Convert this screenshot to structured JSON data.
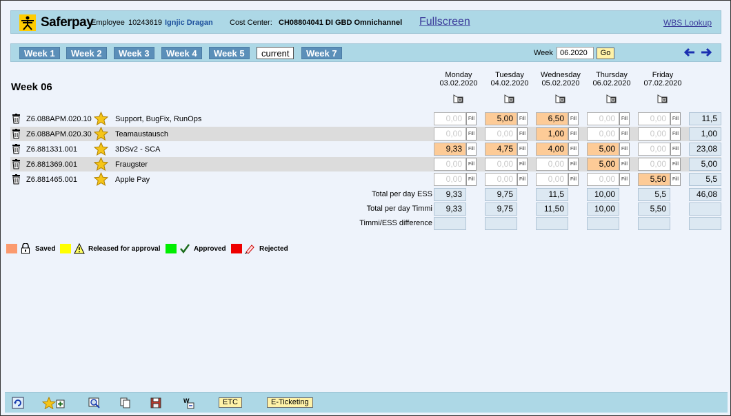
{
  "header": {
    "brand": "Saferpay",
    "employee_label": "Employee",
    "employee_id": "10243619",
    "employee_name": "Ignjic Dragan",
    "cost_center_label": "Cost Center:",
    "cost_center_value": "CH08804041 DI GBD Omnichannel",
    "fullscreen_link": "Fullscreen",
    "wbs_link": "WBS Lookup"
  },
  "week_nav": {
    "tabs": [
      {
        "label": "Week 1"
      },
      {
        "label": "Week 2"
      },
      {
        "label": "Week 3"
      },
      {
        "label": "Week 4"
      },
      {
        "label": "Week 5"
      },
      {
        "label": "current"
      },
      {
        "label": "Week 7"
      }
    ],
    "week_label": "Week",
    "week_value": "06.2020",
    "go_label": "Go"
  },
  "title": "Week 06",
  "days": [
    {
      "name": "Monday",
      "date": "03.02.2020"
    },
    {
      "name": "Tuesday",
      "date": "04.02.2020"
    },
    {
      "name": "Wednesday",
      "date": "05.02.2020"
    },
    {
      "name": "Thursday",
      "date": "06.02.2020"
    },
    {
      "name": "Friday",
      "date": "07.02.2020"
    }
  ],
  "fill_label": "Fill",
  "rows": [
    {
      "wbs": "Z6.088APM.020.10",
      "desc": "Support, BugFix, RunOps",
      "values": [
        "0,00",
        "5,00",
        "6,50",
        "0,00",
        "0,00"
      ],
      "total": "11,5"
    },
    {
      "wbs": "Z6.088APM.020.30",
      "desc": "Teamaustausch",
      "values": [
        "0,00",
        "0,00",
        "1,00",
        "0,00",
        "0,00"
      ],
      "total": "1,00"
    },
    {
      "wbs": "Z6.881331.001",
      "desc": "3DSv2 - SCA",
      "values": [
        "9,33",
        "4,75",
        "4,00",
        "5,00",
        "0,00"
      ],
      "total": "23,08"
    },
    {
      "wbs": "Z6.881369.001",
      "desc": "Fraugster",
      "values": [
        "0,00",
        "0,00",
        "0,00",
        "5,00",
        "0,00"
      ],
      "total": "5,00"
    },
    {
      "wbs": "Z6.881465.001",
      "desc": "Apple Pay",
      "values": [
        "0,00",
        "0,00",
        "0,00",
        "0,00",
        "5,50"
      ],
      "total": "5,5"
    }
  ],
  "summary": {
    "ess_label": "Total per day ESS",
    "ess_values": [
      "9,33",
      "9,75",
      "11,5",
      "10,00",
      "5,5"
    ],
    "ess_total": "46,08",
    "timmi_label": "Total per day Timmi",
    "timmi_values": [
      "9,33",
      "9,75",
      "11,50",
      "10,00",
      "5,50"
    ],
    "diff_label": "Timmi/ESS difference"
  },
  "legend": [
    {
      "label": "Saved",
      "color": "#fb9a6e",
      "icon": "lock-icon"
    },
    {
      "label": "Released for approval",
      "color": "#ffff00",
      "icon": "warning-icon"
    },
    {
      "label": "Approved",
      "color": "#00ee00",
      "icon": "checkmark-icon"
    },
    {
      "label": "Rejected",
      "color": "#ee0000",
      "icon": "pen-icon"
    }
  ],
  "footer": {
    "etc_label": "ETC",
    "eticketing_label": "E-Ticketing"
  },
  "colors": {
    "bar": "#add8e6",
    "tab": "#5b8fb9",
    "filled_cell": "#fdcb97",
    "button": "#fff2a8"
  }
}
